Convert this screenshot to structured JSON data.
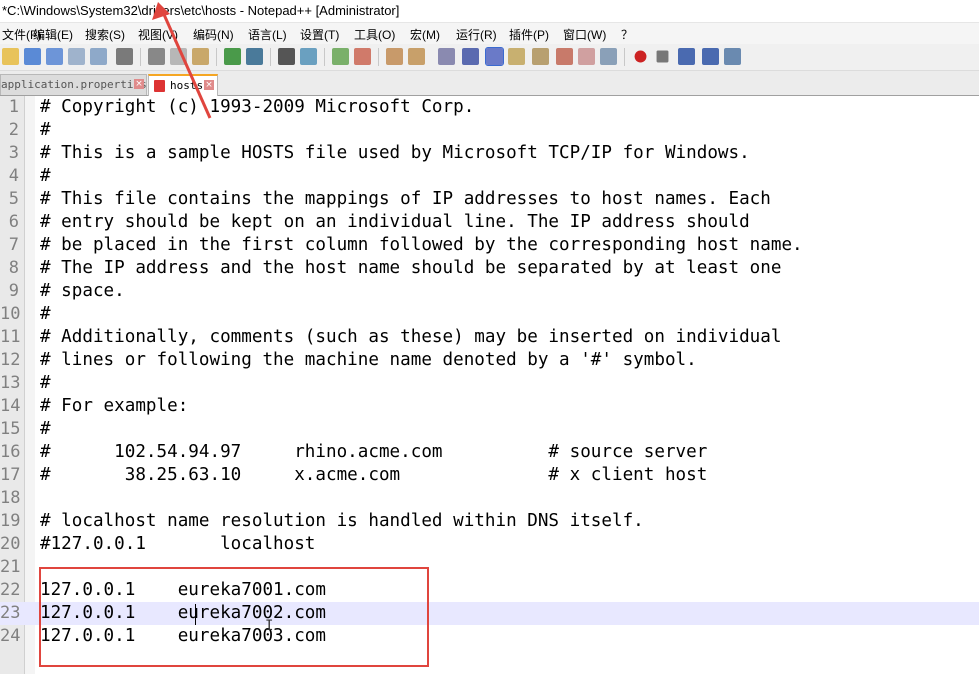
{
  "window": {
    "title": "*C:\\Windows\\System32\\drivers\\etc\\hosts - Notepad++ [Administrator]"
  },
  "menu": [
    "文件(F)",
    "编辑(E)",
    "搜索(S)",
    "视图(V)",
    "编码(N)",
    "语言(L)",
    "设置(T)",
    "工具(O)",
    "宏(M)",
    "运行(R)",
    "插件(P)",
    "窗口(W)",
    "？"
  ],
  "tabs": [
    {
      "label": "application.properties",
      "active": false
    },
    {
      "label": "hosts",
      "active": true
    }
  ],
  "editor": {
    "current_line": 23,
    "lines": [
      {
        "num": "1",
        "text": "# Copyright (c) 1993-2009 Microsoft Corp."
      },
      {
        "num": "2",
        "text": "#"
      },
      {
        "num": "3",
        "text": "# This is a sample HOSTS file used by Microsoft TCP/IP for Windows."
      },
      {
        "num": "4",
        "text": "#"
      },
      {
        "num": "5",
        "text": "# This file contains the mappings of IP addresses to host names. Each"
      },
      {
        "num": "6",
        "text": "# entry should be kept on an individual line. The IP address should"
      },
      {
        "num": "7",
        "text": "# be placed in the first column followed by the corresponding host name."
      },
      {
        "num": "8",
        "text": "# The IP address and the host name should be separated by at least one"
      },
      {
        "num": "9",
        "text": "# space."
      },
      {
        "num": "10",
        "text": "#"
      },
      {
        "num": "11",
        "text": "# Additionally, comments (such as these) may be inserted on individual"
      },
      {
        "num": "12",
        "text": "# lines or following the machine name denoted by a '#' symbol."
      },
      {
        "num": "13",
        "text": "#"
      },
      {
        "num": "14",
        "text": "# For example:"
      },
      {
        "num": "15",
        "text": "#"
      },
      {
        "num": "16",
        "text": "#      102.54.94.97     rhino.acme.com          # source server"
      },
      {
        "num": "17",
        "text": "#       38.25.63.10     x.acme.com              # x client host"
      },
      {
        "num": "18",
        "text": ""
      },
      {
        "num": "19",
        "text": "# localhost name resolution is handled within DNS itself."
      },
      {
        "num": "20",
        "text": "#127.0.0.1       localhost"
      },
      {
        "num": "21",
        "text": ""
      },
      {
        "num": "22",
        "text": "127.0.0.1    eureka7001.com"
      },
      {
        "num": "23",
        "text": "127.0.0.1    eureka7002.com"
      },
      {
        "num": "24",
        "text": "127.0.0.1    eureka7003.com"
      }
    ]
  },
  "colors": {
    "highlight_box": "#e0453e",
    "arrow": "#e0453e",
    "current_line": "#e8e8ff",
    "tab_accent": "#f5a623"
  }
}
